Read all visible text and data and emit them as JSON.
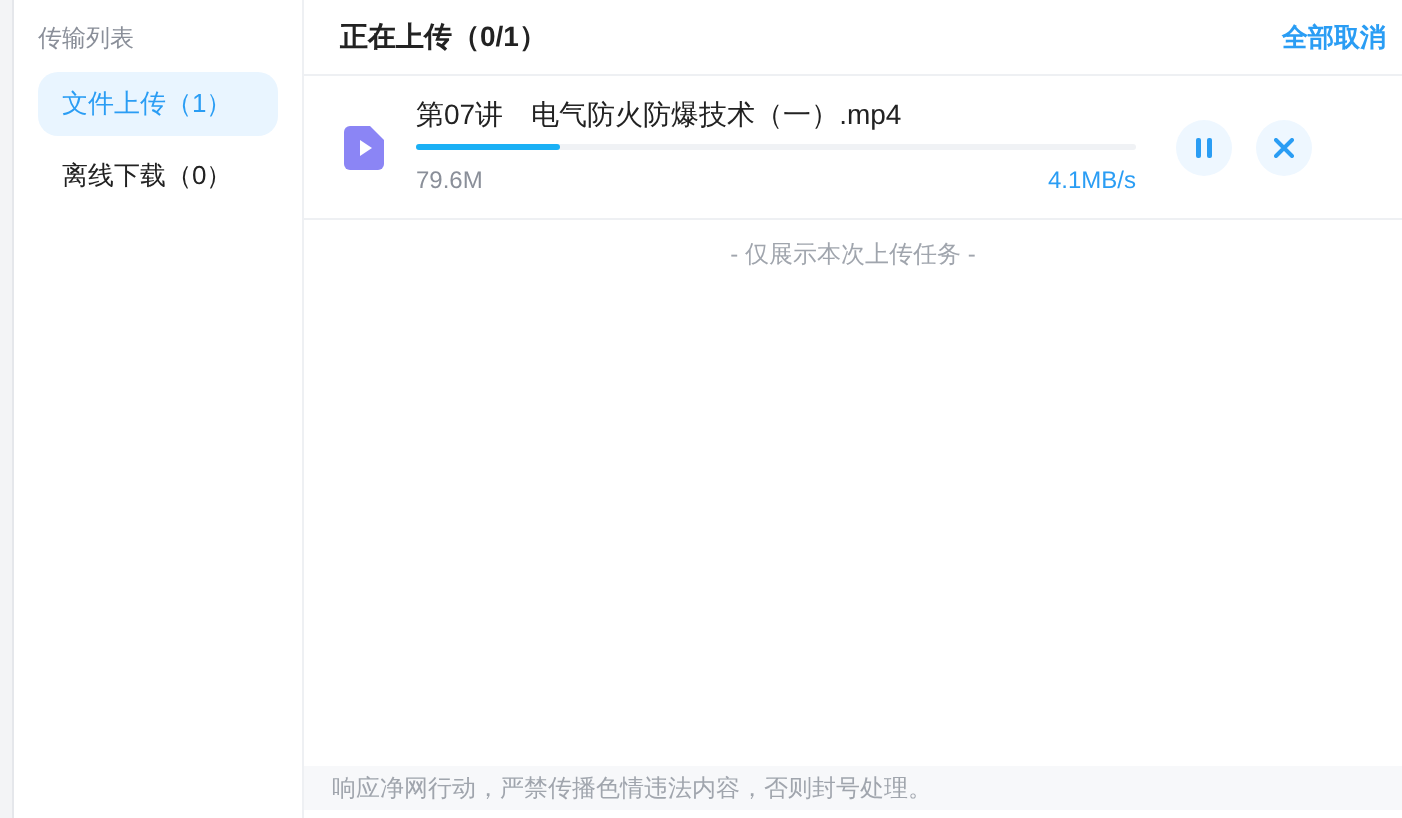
{
  "sidebar": {
    "title": "传输列表",
    "items": [
      {
        "label": "文件上传（1）",
        "selected": true
      },
      {
        "label": "离线下载（0）",
        "selected": false
      }
    ]
  },
  "header": {
    "title": "正在上传（0/1）",
    "action": "全部取消"
  },
  "tasks": [
    {
      "name": "第07讲　电气防火防爆技术（一）.mp4",
      "size": "79.6M",
      "speed": "4.1MB/s",
      "level": 0.2
    }
  ],
  "footer_hint": "- 仅展示本次上传任务 -",
  "notice": "响应净网行动，严禁传播色情违法内容，否则封号处理。"
}
